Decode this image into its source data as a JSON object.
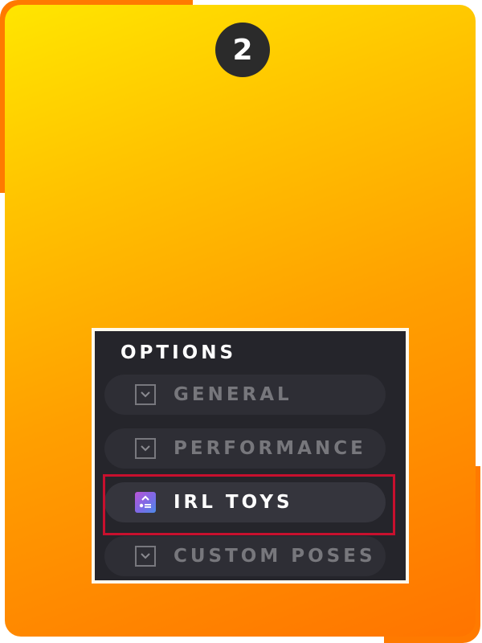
{
  "step": {
    "number": "2"
  },
  "options": {
    "title": "OPTIONS",
    "items": [
      {
        "label": "GENERAL",
        "icon": "chevron-down-icon",
        "active": false
      },
      {
        "label": "PERFORMANCE",
        "icon": "chevron-down-icon",
        "active": false
      },
      {
        "label": "IRL TOYS",
        "icon": "toy-settings-icon",
        "active": true
      },
      {
        "label": "CUSTOM POSES",
        "icon": "chevron-down-icon",
        "active": false
      }
    ]
  },
  "colors": {
    "card_gradient_top": "#ffe600",
    "card_gradient_bottom": "#ff7400",
    "panel_background": "#25252b",
    "highlight_border": "#c8102e",
    "inactive_text": "#77777c",
    "active_text": "#ffffff"
  }
}
